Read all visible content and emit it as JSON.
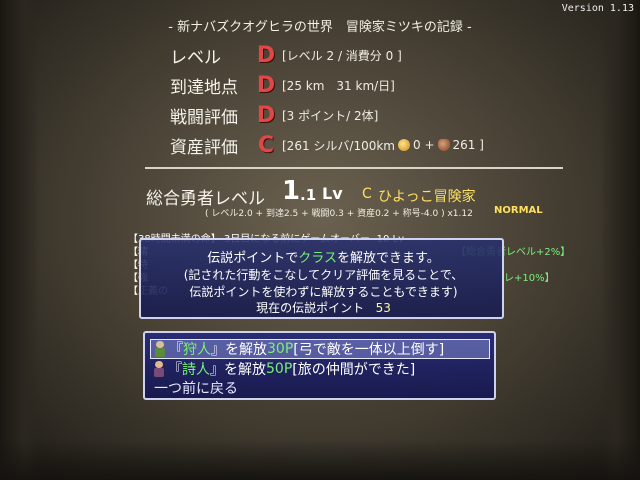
{
  "version": "Version 1.13",
  "title": "- 新ナバズクオグヒラの世界　冒険家ミツキの記録 -",
  "stats": [
    {
      "label": "レベル",
      "grade": "D",
      "detail": "[レベル 2 / 消費分 0 ]"
    },
    {
      "label": "到達地点",
      "grade": "D",
      "detail": "[25 km　31 km/日]"
    },
    {
      "label": "戦闘評価",
      "grade": "D",
      "detail": "[3 ポイント/ 2体]"
    },
    {
      "label": "資産評価",
      "grade": "C",
      "detail_prefix": "[261 シルバ/100km",
      "detail_coin": "0 +",
      "detail_bag": "261 ]"
    }
  ],
  "overall": {
    "label": "総合勇者レベル",
    "value": "1",
    "decimal": ".1",
    "unit": "Lv",
    "rank_letter": "C",
    "rank": "ひよっこ冒険家",
    "breakdown": "( レベル2.0 + 到達2.5 + 戦闘0.3 + 資産0.2 + 称号-4.0 ) x1.12",
    "mode": "NORMAL"
  },
  "logs": [
    {
      "text": "【38時間未満の命】 3日目になる前にゲームオーバー -10 Lv"
    },
    {
      "text": "【精"
    },
    {
      "text": "【特"
    },
    {
      "text": "【強"
    },
    {
      "text": "【正義の"
    }
  ],
  "log_right": {
    "line2": "【総合勇者レベル+2%】",
    "line4": "レ+10%】"
  },
  "info": {
    "line1_a": "伝説ポイントで",
    "line1_b": "クラス",
    "line1_c": "を解放できます。",
    "line2": "(記された行動をこなしてクリア評価を見ることで、",
    "line3": "伝説ポイントを使わずに解放することもできます)",
    "line4_label": "現在の伝説ポイント",
    "line4_value": "53"
  },
  "menu": {
    "items": [
      {
        "open": "『",
        "name": "狩人",
        "close": "』を解放 ",
        "cost": "30P",
        "condition": "[弓で敵を一体以上倒す]"
      },
      {
        "open": "『",
        "name": "詩人",
        "close": "』を解放 ",
        "cost": "50P",
        "condition": "[旅の仲間ができた]"
      }
    ],
    "back": "一つ前に戻る"
  },
  "colors": {
    "grade_red": "#e04848",
    "accent_green": "#78f078",
    "accent_yellow": "#ffe060",
    "window_blue": "#262a78"
  }
}
